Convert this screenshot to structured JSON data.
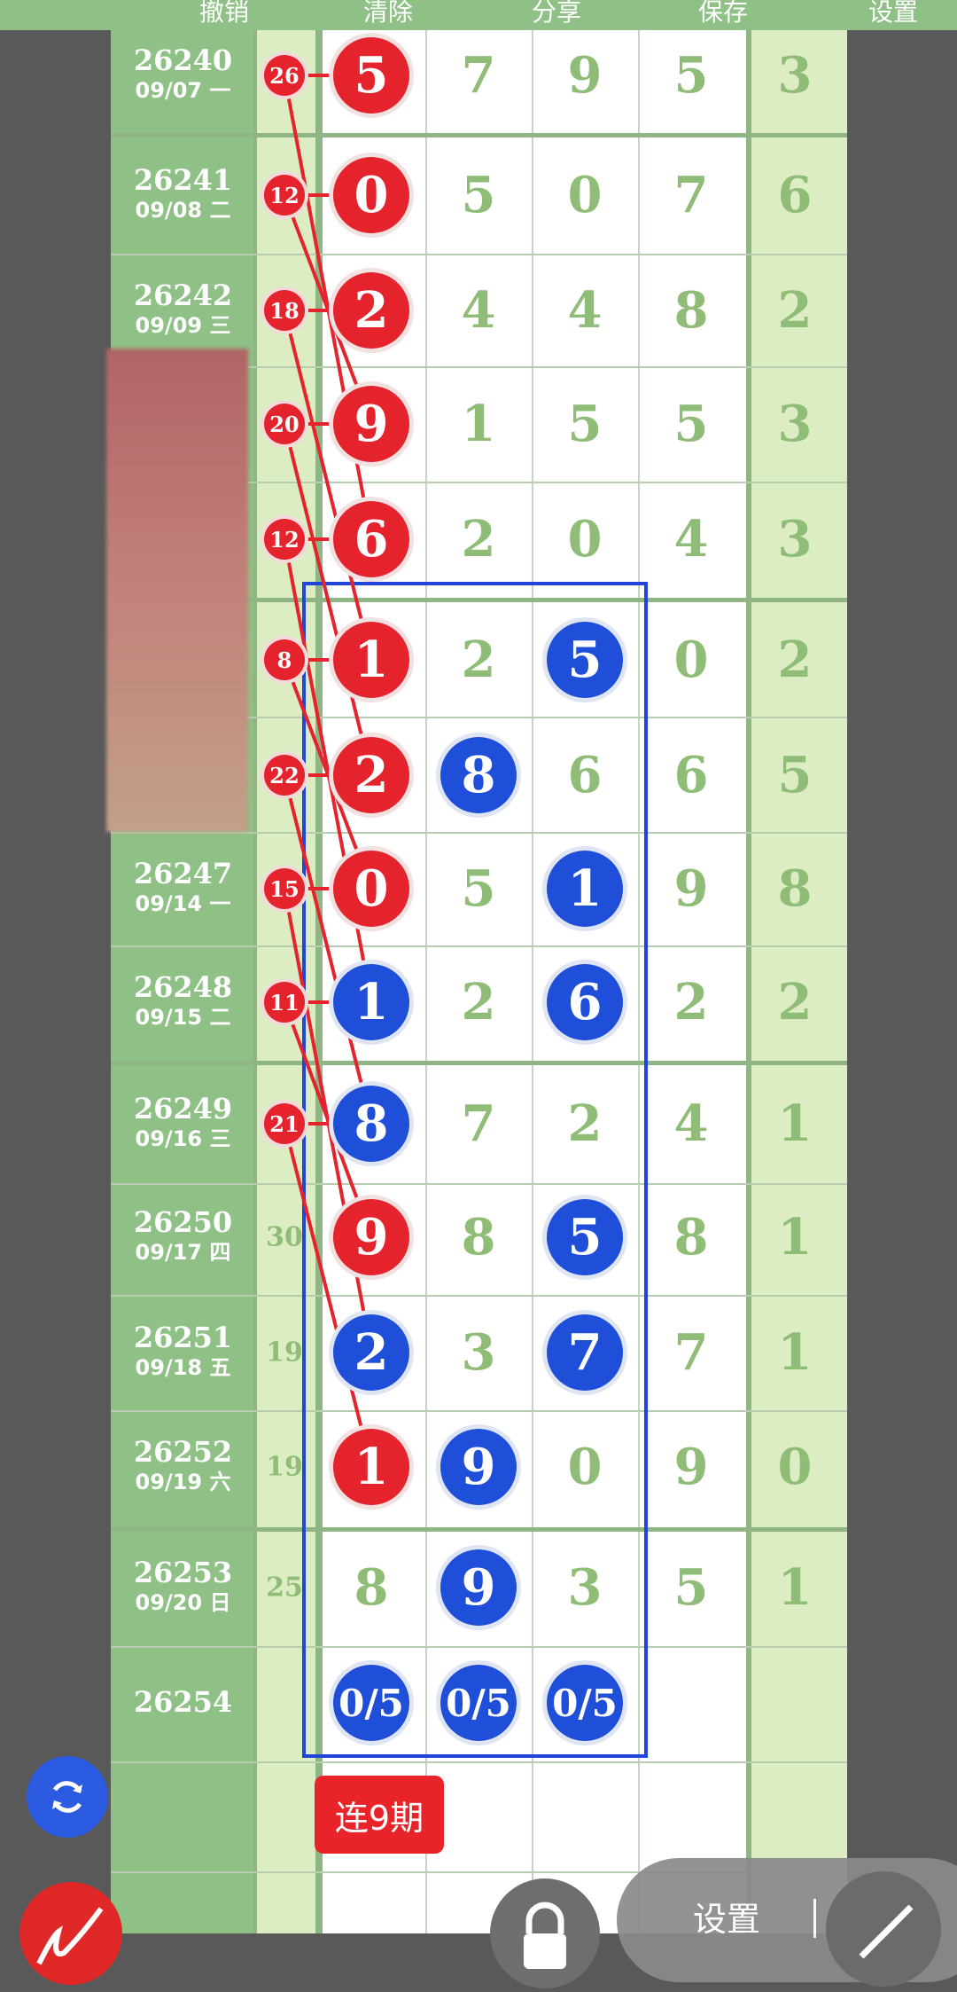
{
  "toolbar": {
    "undo": "撤销",
    "clear": "清除",
    "share": "分享",
    "save": "保存",
    "settings": "设置"
  },
  "rows": [
    {
      "issue": "26240",
      "date": "09/07 一"
    },
    {
      "issue": "26241",
      "date": "09/08 二"
    },
    {
      "issue": "26242",
      "date": "09/09 三"
    },
    {
      "issue": "",
      "date": ""
    },
    {
      "issue": "",
      "date": ""
    },
    {
      "issue": "",
      "date": ""
    },
    {
      "issue": "",
      "date": ""
    },
    {
      "issue": "26247",
      "date": "09/14 一"
    },
    {
      "issue": "26248",
      "date": "09/15 二"
    },
    {
      "issue": "26249",
      "date": "09/16 三"
    },
    {
      "issue": "26250",
      "date": "09/17 四"
    },
    {
      "issue": "26251",
      "date": "09/18 五"
    },
    {
      "issue": "26252",
      "date": "09/19 六"
    },
    {
      "issue": "26253",
      "date": "09/20 日"
    },
    {
      "issue": "26254",
      "date": ""
    }
  ],
  "red_markers": [
    "26",
    "12",
    "18",
    "20",
    "12",
    "8",
    "22",
    "15",
    "11",
    "21",
    "30",
    "19",
    "19",
    "25",
    ""
  ],
  "digits": [
    [
      "5",
      "7",
      "9",
      "5",
      "3"
    ],
    [
      "0",
      "5",
      "0",
      "7",
      "6"
    ],
    [
      "2",
      "4",
      "4",
      "8",
      "2"
    ],
    [
      "9",
      "1",
      "5",
      "5",
      "3"
    ],
    [
      "6",
      "2",
      "0",
      "4",
      "3"
    ],
    [
      "1",
      "2",
      "5",
      "0",
      "2"
    ],
    [
      "2",
      "8",
      "6",
      "6",
      "5"
    ],
    [
      "0",
      "5",
      "1",
      "9",
      "8"
    ],
    [
      "1",
      "2",
      "6",
      "2",
      "2"
    ],
    [
      "8",
      "7",
      "2",
      "4",
      "1"
    ],
    [
      "9",
      "8",
      "5",
      "8",
      "1"
    ],
    [
      "2",
      "3",
      "7",
      "7",
      "1"
    ],
    [
      "1",
      "9",
      "0",
      "9",
      "0"
    ],
    [
      "8",
      "9",
      "3",
      "5",
      "1"
    ],
    [
      "0/5",
      "0/5",
      "0/5",
      "",
      ""
    ]
  ],
  "streak_label": "连9期",
  "settings_pill_label": "设置",
  "colors": {
    "red": "#e5232c",
    "blue": "#1f4fd8",
    "green": "#8fc085"
  }
}
